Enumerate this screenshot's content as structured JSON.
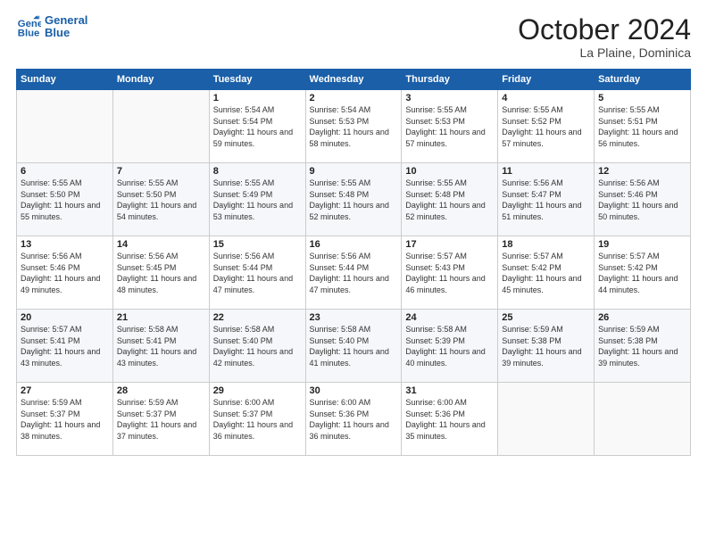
{
  "header": {
    "logo_line1": "General",
    "logo_line2": "Blue",
    "month": "October 2024",
    "location": "La Plaine, Dominica"
  },
  "days_of_week": [
    "Sunday",
    "Monday",
    "Tuesday",
    "Wednesday",
    "Thursday",
    "Friday",
    "Saturday"
  ],
  "weeks": [
    [
      {
        "day": "",
        "sunrise": "",
        "sunset": "",
        "daylight": ""
      },
      {
        "day": "",
        "sunrise": "",
        "sunset": "",
        "daylight": ""
      },
      {
        "day": "1",
        "sunrise": "Sunrise: 5:54 AM",
        "sunset": "Sunset: 5:54 PM",
        "daylight": "Daylight: 11 hours and 59 minutes."
      },
      {
        "day": "2",
        "sunrise": "Sunrise: 5:54 AM",
        "sunset": "Sunset: 5:53 PM",
        "daylight": "Daylight: 11 hours and 58 minutes."
      },
      {
        "day": "3",
        "sunrise": "Sunrise: 5:55 AM",
        "sunset": "Sunset: 5:53 PM",
        "daylight": "Daylight: 11 hours and 57 minutes."
      },
      {
        "day": "4",
        "sunrise": "Sunrise: 5:55 AM",
        "sunset": "Sunset: 5:52 PM",
        "daylight": "Daylight: 11 hours and 57 minutes."
      },
      {
        "day": "5",
        "sunrise": "Sunrise: 5:55 AM",
        "sunset": "Sunset: 5:51 PM",
        "daylight": "Daylight: 11 hours and 56 minutes."
      }
    ],
    [
      {
        "day": "6",
        "sunrise": "Sunrise: 5:55 AM",
        "sunset": "Sunset: 5:50 PM",
        "daylight": "Daylight: 11 hours and 55 minutes."
      },
      {
        "day": "7",
        "sunrise": "Sunrise: 5:55 AM",
        "sunset": "Sunset: 5:50 PM",
        "daylight": "Daylight: 11 hours and 54 minutes."
      },
      {
        "day": "8",
        "sunrise": "Sunrise: 5:55 AM",
        "sunset": "Sunset: 5:49 PM",
        "daylight": "Daylight: 11 hours and 53 minutes."
      },
      {
        "day": "9",
        "sunrise": "Sunrise: 5:55 AM",
        "sunset": "Sunset: 5:48 PM",
        "daylight": "Daylight: 11 hours and 52 minutes."
      },
      {
        "day": "10",
        "sunrise": "Sunrise: 5:55 AM",
        "sunset": "Sunset: 5:48 PM",
        "daylight": "Daylight: 11 hours and 52 minutes."
      },
      {
        "day": "11",
        "sunrise": "Sunrise: 5:56 AM",
        "sunset": "Sunset: 5:47 PM",
        "daylight": "Daylight: 11 hours and 51 minutes."
      },
      {
        "day": "12",
        "sunrise": "Sunrise: 5:56 AM",
        "sunset": "Sunset: 5:46 PM",
        "daylight": "Daylight: 11 hours and 50 minutes."
      }
    ],
    [
      {
        "day": "13",
        "sunrise": "Sunrise: 5:56 AM",
        "sunset": "Sunset: 5:46 PM",
        "daylight": "Daylight: 11 hours and 49 minutes."
      },
      {
        "day": "14",
        "sunrise": "Sunrise: 5:56 AM",
        "sunset": "Sunset: 5:45 PM",
        "daylight": "Daylight: 11 hours and 48 minutes."
      },
      {
        "day": "15",
        "sunrise": "Sunrise: 5:56 AM",
        "sunset": "Sunset: 5:44 PM",
        "daylight": "Daylight: 11 hours and 47 minutes."
      },
      {
        "day": "16",
        "sunrise": "Sunrise: 5:56 AM",
        "sunset": "Sunset: 5:44 PM",
        "daylight": "Daylight: 11 hours and 47 minutes."
      },
      {
        "day": "17",
        "sunrise": "Sunrise: 5:57 AM",
        "sunset": "Sunset: 5:43 PM",
        "daylight": "Daylight: 11 hours and 46 minutes."
      },
      {
        "day": "18",
        "sunrise": "Sunrise: 5:57 AM",
        "sunset": "Sunset: 5:42 PM",
        "daylight": "Daylight: 11 hours and 45 minutes."
      },
      {
        "day": "19",
        "sunrise": "Sunrise: 5:57 AM",
        "sunset": "Sunset: 5:42 PM",
        "daylight": "Daylight: 11 hours and 44 minutes."
      }
    ],
    [
      {
        "day": "20",
        "sunrise": "Sunrise: 5:57 AM",
        "sunset": "Sunset: 5:41 PM",
        "daylight": "Daylight: 11 hours and 43 minutes."
      },
      {
        "day": "21",
        "sunrise": "Sunrise: 5:58 AM",
        "sunset": "Sunset: 5:41 PM",
        "daylight": "Daylight: 11 hours and 43 minutes."
      },
      {
        "day": "22",
        "sunrise": "Sunrise: 5:58 AM",
        "sunset": "Sunset: 5:40 PM",
        "daylight": "Daylight: 11 hours and 42 minutes."
      },
      {
        "day": "23",
        "sunrise": "Sunrise: 5:58 AM",
        "sunset": "Sunset: 5:40 PM",
        "daylight": "Daylight: 11 hours and 41 minutes."
      },
      {
        "day": "24",
        "sunrise": "Sunrise: 5:58 AM",
        "sunset": "Sunset: 5:39 PM",
        "daylight": "Daylight: 11 hours and 40 minutes."
      },
      {
        "day": "25",
        "sunrise": "Sunrise: 5:59 AM",
        "sunset": "Sunset: 5:38 PM",
        "daylight": "Daylight: 11 hours and 39 minutes."
      },
      {
        "day": "26",
        "sunrise": "Sunrise: 5:59 AM",
        "sunset": "Sunset: 5:38 PM",
        "daylight": "Daylight: 11 hours and 39 minutes."
      }
    ],
    [
      {
        "day": "27",
        "sunrise": "Sunrise: 5:59 AM",
        "sunset": "Sunset: 5:37 PM",
        "daylight": "Daylight: 11 hours and 38 minutes."
      },
      {
        "day": "28",
        "sunrise": "Sunrise: 5:59 AM",
        "sunset": "Sunset: 5:37 PM",
        "daylight": "Daylight: 11 hours and 37 minutes."
      },
      {
        "day": "29",
        "sunrise": "Sunrise: 6:00 AM",
        "sunset": "Sunset: 5:37 PM",
        "daylight": "Daylight: 11 hours and 36 minutes."
      },
      {
        "day": "30",
        "sunrise": "Sunrise: 6:00 AM",
        "sunset": "Sunset: 5:36 PM",
        "daylight": "Daylight: 11 hours and 36 minutes."
      },
      {
        "day": "31",
        "sunrise": "Sunrise: 6:00 AM",
        "sunset": "Sunset: 5:36 PM",
        "daylight": "Daylight: 11 hours and 35 minutes."
      },
      {
        "day": "",
        "sunrise": "",
        "sunset": "",
        "daylight": ""
      },
      {
        "day": "",
        "sunrise": "",
        "sunset": "",
        "daylight": ""
      }
    ]
  ]
}
